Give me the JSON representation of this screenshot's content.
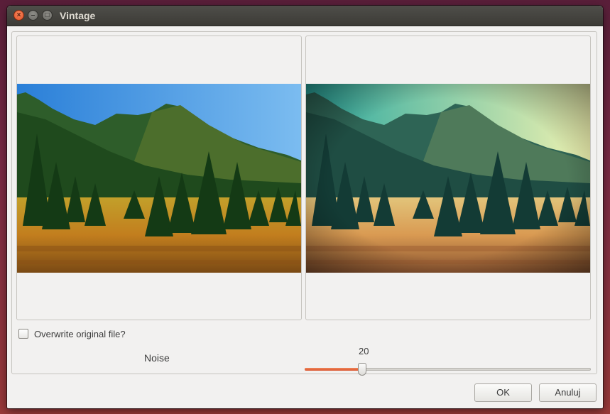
{
  "window": {
    "title": "Vintage"
  },
  "options": {
    "overwrite_label": "Overwrite original file?",
    "overwrite_checked": false
  },
  "noise": {
    "label": "Noise",
    "value": "20",
    "fraction": 0.2
  },
  "buttons": {
    "ok": "OK",
    "cancel": "Anuluj"
  },
  "colors": {
    "accent": "#e05a2d",
    "titlebar": "#3c3b37",
    "background": "#f2f1f0"
  }
}
